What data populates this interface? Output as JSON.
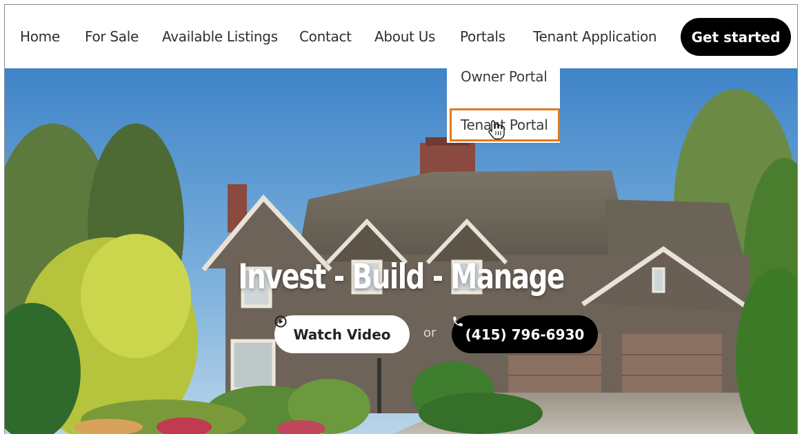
{
  "nav": {
    "items": [
      {
        "label": "Home"
      },
      {
        "label": "For Sale"
      },
      {
        "label": "Available Listings"
      },
      {
        "label": "Contact"
      },
      {
        "label": "About Us"
      },
      {
        "label": "Portals"
      },
      {
        "label": "Tenant Application"
      }
    ],
    "cta_label": "Get started"
  },
  "dropdown": {
    "items": [
      {
        "label": "Owner Portal"
      },
      {
        "label": "Tenant Portal"
      }
    ],
    "hovered_item": "Tenant Portal"
  },
  "hero": {
    "headline": "Invest - Build - Manage",
    "watch_label": "Watch Video",
    "or_text": "or",
    "phone_label": "(415) 796-6930",
    "watch_icon": "play-circle-icon",
    "phone_icon": "phone-icon"
  },
  "colors": {
    "highlight": "#e07a1f",
    "cta_bg": "#000000",
    "nav_text": "#2f2f2f",
    "sky": "#3f84c9",
    "roof": "#6b6557",
    "stone": "#6e6358"
  }
}
